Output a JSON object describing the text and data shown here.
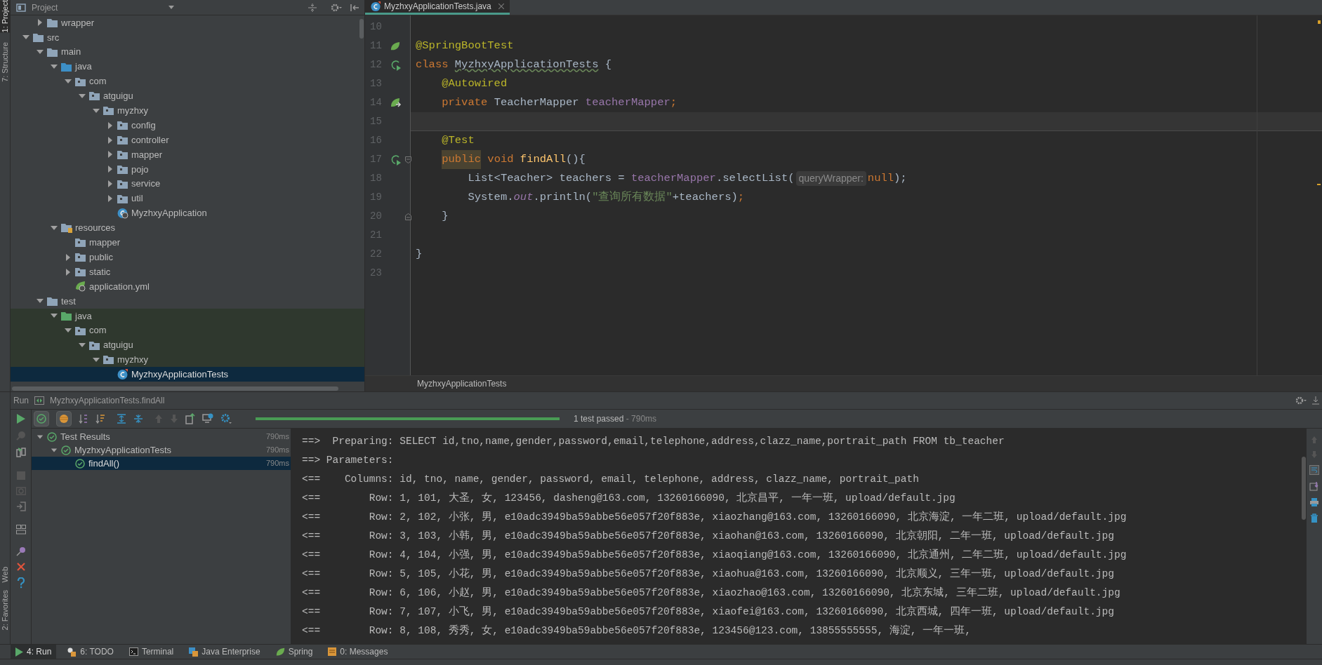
{
  "left_stripe": {
    "top": [
      {
        "label": "1: Project",
        "selected": true
      },
      {
        "label": "7: Structure",
        "selected": false
      }
    ],
    "bottom": [
      {
        "label": "Web",
        "selected": false
      },
      {
        "label": "2: Favorites",
        "selected": false
      }
    ]
  },
  "project": {
    "title": "Project",
    "partial_branch": [
      {
        "label": "wrapper",
        "kind": "folder",
        "expanded": false,
        "selected": false
      }
    ],
    "tree": [
      {
        "label": "src",
        "kind": "folder",
        "expanded": true,
        "selected": false,
        "children": [
          {
            "label": "main",
            "kind": "folder",
            "expanded": true,
            "selected": false,
            "children": [
              {
                "label": "java",
                "kind": "source",
                "expanded": true,
                "selected": false,
                "children": [
                  {
                    "label": "com",
                    "kind": "package",
                    "expanded": true,
                    "selected": false,
                    "children": [
                      {
                        "label": "atguigu",
                        "kind": "package",
                        "expanded": true,
                        "selected": false,
                        "children": [
                          {
                            "label": "myzhxy",
                            "kind": "package",
                            "expanded": true,
                            "selected": false,
                            "children": [
                              {
                                "label": "config",
                                "kind": "package",
                                "expanded": false,
                                "selected": false
                              },
                              {
                                "label": "controller",
                                "kind": "package",
                                "expanded": false,
                                "selected": false
                              },
                              {
                                "label": "mapper",
                                "kind": "package",
                                "expanded": false,
                                "selected": false
                              },
                              {
                                "label": "pojo",
                                "kind": "package",
                                "expanded": false,
                                "selected": false
                              },
                              {
                                "label": "service",
                                "kind": "package",
                                "expanded": false,
                                "selected": false
                              },
                              {
                                "label": "util",
                                "kind": "package",
                                "expanded": false,
                                "selected": false
                              },
                              {
                                "label": "MyzhxyApplication",
                                "kind": "spring-class",
                                "selected": false
                              }
                            ]
                          }
                        ]
                      }
                    ]
                  }
                ]
              },
              {
                "label": "resources",
                "kind": "resources",
                "expanded": true,
                "selected": false,
                "children": [
                  {
                    "label": "mapper",
                    "kind": "package",
                    "selected": false
                  },
                  {
                    "label": "public",
                    "kind": "package",
                    "expanded": false,
                    "selected": false
                  },
                  {
                    "label": "static",
                    "kind": "package",
                    "expanded": false,
                    "selected": false
                  },
                  {
                    "label": "application.yml",
                    "kind": "yml",
                    "selected": false
                  }
                ]
              }
            ]
          },
          {
            "label": "test",
            "kind": "folder",
            "expanded": true,
            "selected": false,
            "children": [
              {
                "label": "java",
                "kind": "test-source",
                "expanded": true,
                "selected": false,
                "children": [
                  {
                    "label": "com",
                    "kind": "package",
                    "expanded": true,
                    "selected": false,
                    "children": [
                      {
                        "label": "atguigu",
                        "kind": "package",
                        "expanded": true,
                        "selected": false,
                        "children": [
                          {
                            "label": "myzhxy",
                            "kind": "package",
                            "expanded": true,
                            "selected": false,
                            "children": [
                              {
                                "label": "MyzhxyApplicationTests",
                                "kind": "test-class",
                                "selected": true
                              }
                            ]
                          }
                        ]
                      }
                    ]
                  }
                ]
              }
            ]
          }
        ]
      }
    ]
  },
  "editor": {
    "tab": {
      "label": "MyzhxyApplicationTests.java",
      "selected": true
    },
    "lines": [
      {
        "number": "10"
      },
      {
        "number": "11",
        "marker": {
          "kind": "spring"
        },
        "tokens": [
          {
            "t": "@SpringBootTest",
            "kind": "annotation"
          }
        ]
      },
      {
        "number": "12",
        "marker": {
          "kind": "run"
        },
        "tokens": [
          {
            "t": "class ",
            "kind": "keyword"
          },
          {
            "t": "MyzhxyApplicationTests",
            "kind": "plain",
            "warning": true
          },
          {
            "t": " {",
            "kind": "plain"
          }
        ]
      },
      {
        "number": "13",
        "tokens": [
          {
            "t": "    @Autowired",
            "kind": "annotation"
          }
        ]
      },
      {
        "number": "14",
        "marker": {
          "kind": "bean"
        },
        "tokens": [
          {
            "t": "    private ",
            "kind": "keyword"
          },
          {
            "t": "TeacherMapper ",
            "kind": "plain"
          },
          {
            "t": "teacherMapper",
            "kind": "field"
          },
          {
            "t": ";",
            "kind": "keyword"
          }
        ]
      },
      {
        "number": "15",
        "current": true
      },
      {
        "number": "16",
        "tokens": [
          {
            "t": "    @Test",
            "kind": "annotation"
          }
        ]
      },
      {
        "number": "17",
        "marker": {
          "kind": "run"
        },
        "fold": {
          "kind": "start"
        },
        "tokens": [
          {
            "t": "    public",
            "kind": "keyword",
            "highlight": true
          },
          {
            "t": " void ",
            "kind": "keyword"
          },
          {
            "t": "findAll",
            "kind": "method"
          },
          {
            "t": "(){",
            "kind": "plain"
          }
        ]
      },
      {
        "number": "18",
        "tokens": [
          {
            "t": "        List<Teacher> teachers = ",
            "kind": "plain"
          },
          {
            "t": "teacherMapper",
            "kind": "field"
          },
          {
            "t": ".selectList(",
            "kind": "plain"
          },
          {
            "t": "queryWrapper:",
            "kind": "hint"
          },
          {
            "t": "null",
            "kind": "keyword"
          },
          {
            "t": ");",
            "kind": "plain"
          }
        ]
      },
      {
        "number": "19",
        "tokens": [
          {
            "t": "        System.",
            "kind": "plain"
          },
          {
            "t": "out",
            "kind": "static-field"
          },
          {
            "t": ".println(",
            "kind": "plain"
          },
          {
            "t": "\"查询所有数据\"",
            "kind": "string"
          },
          {
            "t": "+teachers)",
            "kind": "plain"
          },
          {
            "t": ";",
            "kind": "keyword"
          }
        ]
      },
      {
        "number": "20",
        "fold": {
          "kind": "end"
        },
        "tokens": [
          {
            "t": "    }",
            "kind": "plain"
          }
        ]
      },
      {
        "number": "21"
      },
      {
        "number": "22",
        "tokens": [
          {
            "t": "}",
            "kind": "plain"
          }
        ]
      },
      {
        "number": "23"
      }
    ],
    "breadcrumb": "MyzhxyApplicationTests"
  },
  "run": {
    "title": "Run",
    "config": "MyzhxyApplicationTests.findAll",
    "progress": {
      "level": 1,
      "status": "1 test passed",
      "duration": " - 790ms"
    },
    "tests": [
      {
        "label": "Test Results",
        "time": "790ms",
        "kind": "passed",
        "expanded": true,
        "selected": false,
        "children": [
          {
            "label": "MyzhxyApplicationTests",
            "time": "790ms",
            "kind": "passed",
            "expanded": true,
            "selected": false,
            "children": [
              {
                "label": "findAll()",
                "time": "790ms",
                "kind": "passed",
                "selected": true
              }
            ]
          }
        ]
      }
    ],
    "console": [
      "==>  Preparing: SELECT id,tno,name,gender,password,email,telephone,address,clazz_name,portrait_path FROM tb_teacher",
      "==> Parameters: ",
      "<==    Columns: id, tno, name, gender, password, email, telephone, address, clazz_name, portrait_path",
      "<==        Row: 1, 101, 大圣, 女, 123456, dasheng@163.com, 13260166090, 北京昌平, 一年一班, upload/default.jpg",
      "<==        Row: 2, 102, 小张, 男, e10adc3949ba59abbe56e057f20f883e, xiaozhang@163.com, 13260166090, 北京海淀, 一年二班, upload/default.jpg",
      "<==        Row: 3, 103, 小韩, 男, e10adc3949ba59abbe56e057f20f883e, xiaohan@163.com, 13260166090, 北京朝阳, 二年一班, upload/default.jpg",
      "<==        Row: 4, 104, 小强, 男, e10adc3949ba59abbe56e057f20f883e, xiaoqiang@163.com, 13260166090, 北京通州, 二年二班, upload/default.jpg",
      "<==        Row: 5, 105, 小花, 男, e10adc3949ba59abbe56e057f20f883e, xiaohua@163.com, 13260166090, 北京顺义, 三年一班, upload/default.jpg",
      "<==        Row: 6, 106, 小赵, 男, e10adc3949ba59abbe56e057f20f883e, xiaozhao@163.com, 13260166090, 北京东城, 三年二班, upload/default.jpg",
      "<==        Row: 7, 107, 小飞, 男, e10adc3949ba59abbe56e057f20f883e, xiaofei@163.com, 13260166090, 北京西城, 四年一班, upload/default.jpg",
      "<==        Row: 8, 108, 秀秀, 女, e10adc3949ba59abbe56e057f20f883e, 123456@123.com, 13855555555, 海淀, 一年一班,"
    ]
  },
  "bottom_tabs": [
    {
      "label": "4: Run",
      "kind": "run",
      "selected": true
    },
    {
      "label": "6: TODO",
      "kind": "todo",
      "selected": false
    },
    {
      "label": "Terminal",
      "kind": "terminal",
      "selected": false
    },
    {
      "label": "Java Enterprise",
      "kind": "enterprise",
      "selected": false
    },
    {
      "label": "Spring",
      "kind": "spring",
      "selected": false
    },
    {
      "label": "0: Messages",
      "kind": "messages",
      "selected": false
    }
  ]
}
